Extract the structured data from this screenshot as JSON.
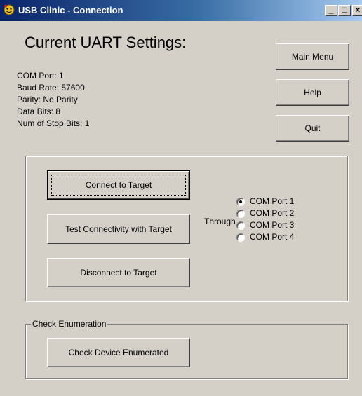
{
  "window": {
    "title": "USB Clinic - Connection",
    "controls": {
      "minimize": "_",
      "maximize": "□",
      "close": "×"
    }
  },
  "settings": {
    "heading": "Current UART Settings:",
    "com_port": "COM Port:  1",
    "baud_rate": "Baud Rate: 57600",
    "parity": "Parity: No Parity",
    "data_bits": "Data Bits: 8",
    "stop_bits": "Num of Stop Bits: 1"
  },
  "menu": {
    "main_menu": "Main Menu",
    "help": "Help",
    "quit": "Quit"
  },
  "connection": {
    "connect": "Connect to Target",
    "test": "Test Connectivity with Target",
    "disconnect": "Disconnect to Target",
    "through": "Through",
    "ports": [
      {
        "label": "COM Port 1",
        "selected": true
      },
      {
        "label": "COM Port 2",
        "selected": false
      },
      {
        "label": "COM Port 3",
        "selected": false
      },
      {
        "label": "COM Port 4",
        "selected": false
      }
    ]
  },
  "enumeration": {
    "group_label": "Check Enumeration",
    "check_button": "Check Device Enumerated"
  },
  "colors": {
    "face": "#d4d0c8",
    "titlebar_start": "#0a246a",
    "titlebar_end": "#a6caf0"
  }
}
